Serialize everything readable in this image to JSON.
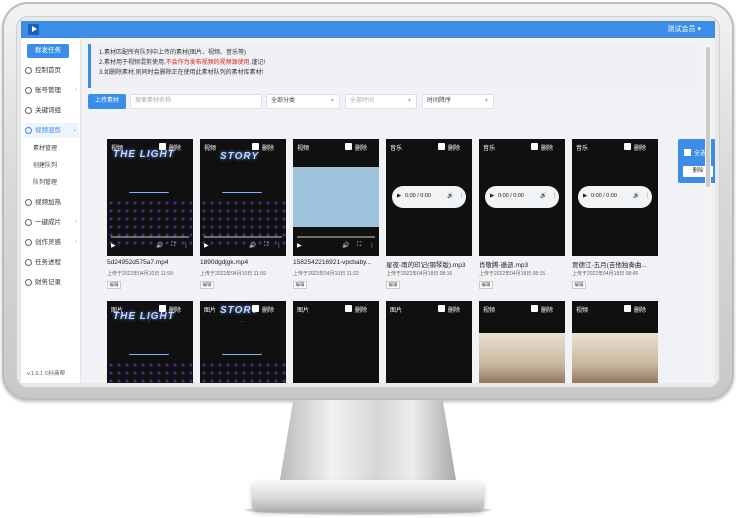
{
  "topbar": {
    "user_menu": "测试会员 ▾"
  },
  "sidebar": {
    "publish_button": "群发任务",
    "items": [
      {
        "label": "控制首页"
      },
      {
        "label": "账号管理",
        "caret": "›"
      },
      {
        "label": "关键词组"
      },
      {
        "label": "视频混剪",
        "caret": "⌄"
      },
      {
        "label": "视频加热"
      },
      {
        "label": "一键成片",
        "caret": "›"
      },
      {
        "label": "创作灵感",
        "caret": "›"
      },
      {
        "label": "任务进程"
      },
      {
        "label": "财务记录"
      }
    ],
    "sub_items": [
      {
        "label": "素材管理"
      },
      {
        "label": "创建队列"
      },
      {
        "label": "队列管理"
      }
    ],
    "version": "v.1.0.1 ©抖商帮"
  },
  "notice": {
    "line1": "1.素材匹配所有队列中上传的素材(图片、视频、音乐等)",
    "line2_prefix": "2.素材用于视频混剪使用,",
    "line2_warn": "不会作为发布视频的视频源使用,",
    "line2_suffix": "谨记!",
    "line3": "3.如删除素材,则同时会删除正在使用此素材队列的素材库素材!"
  },
  "toolbar": {
    "upload_label": "上传素材",
    "search_placeholder": "搜索素材名称",
    "category": "全部分类",
    "time": "全部时间",
    "sort": "时间降序"
  },
  "cards": [
    {
      "type": "视频",
      "delete": "删除",
      "filename": "5d24952d575a7.mp4",
      "uploaded": "上传于2022年04月10日 11:59",
      "edit": "编辑",
      "kind": "video",
      "art": "neon"
    },
    {
      "type": "视频",
      "delete": "删除",
      "filename": "1890dgdjgk.mp4",
      "uploaded": "上传于2022年04月10日 11:59",
      "edit": "编辑",
      "kind": "video",
      "art": "neon2"
    },
    {
      "type": "视频",
      "delete": "删除",
      "filename": "1582542216921-vpcbaby...",
      "uploaded": "上传于2022年04月10日 11:22",
      "edit": "编辑",
      "kind": "video",
      "art": "blue"
    },
    {
      "type": "音乐",
      "delete": "删除",
      "filename": "星夜-雨的印记(钢琴版).mp3",
      "uploaded": "上传于2022年04月18日 08:16",
      "edit": "编辑",
      "kind": "audio",
      "art": "dark"
    },
    {
      "type": "音乐",
      "delete": "删除",
      "filename": "肖敬腾-遁逝.mp3",
      "uploaded": "上传于2022年04月18日 08:15",
      "edit": "编辑",
      "kind": "audio",
      "art": "dark"
    },
    {
      "type": "音乐",
      "delete": "删除",
      "filename": "贾德江-五月(吉他独奏曲...",
      "uploaded": "上传于2022年04月18日 08:45",
      "edit": "编辑",
      "kind": "audio",
      "art": "dark"
    },
    {
      "type": "图片",
      "delete": "删除",
      "kind": "image",
      "art": "neon"
    },
    {
      "type": "图片",
      "delete": "删除",
      "kind": "image",
      "art": "neon2"
    },
    {
      "type": "图片",
      "delete": "删除",
      "kind": "image",
      "art": "store"
    },
    {
      "type": "图片",
      "delete": "删除",
      "kind": "image",
      "art": "store2"
    },
    {
      "type": "视频",
      "delete": "删除",
      "kind": "image",
      "art": "store3"
    },
    {
      "type": "视频",
      "delete": "删除",
      "kind": "image",
      "art": "store3"
    }
  ],
  "video_controls": {
    "play": "▶",
    "volume": "🔊",
    "fullscreen": "⛶",
    "more": "⋮"
  },
  "audio_controls": {
    "play": "▶",
    "time": "0:00 / 0:00",
    "volume": "🔊",
    "more": "⋮"
  },
  "neon_text": {
    "title1": "THE LIGHT",
    "title2": "STORY"
  },
  "select_panel": {
    "all_label": "全选",
    "delete_label": "删除"
  },
  "colors": {
    "accent": "#3b8de8",
    "warn": "#e02020"
  }
}
